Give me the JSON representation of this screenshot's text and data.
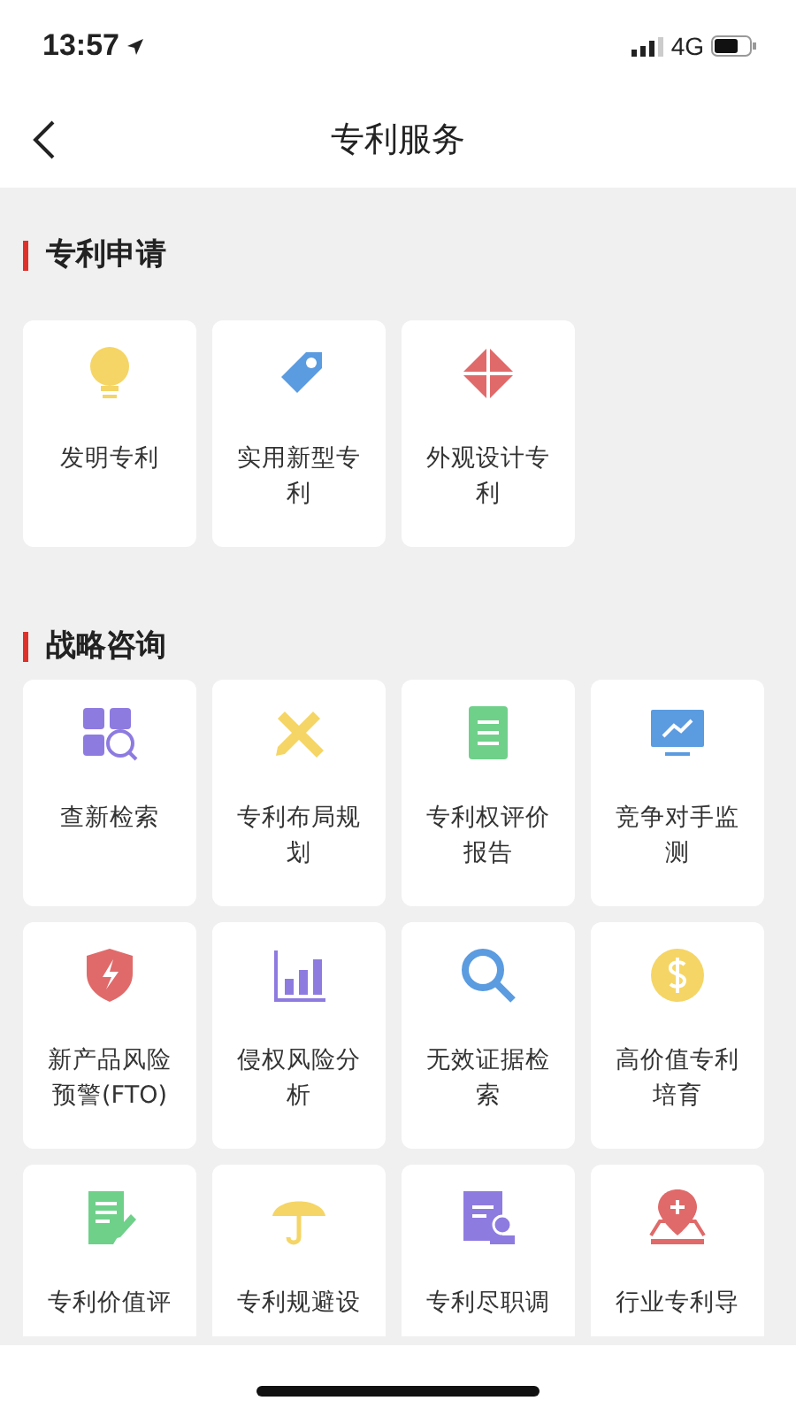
{
  "status_bar": {
    "time": "13:57",
    "network": "4G"
  },
  "nav": {
    "title": "专利服务"
  },
  "sections": [
    {
      "title": "专利申请",
      "items": [
        {
          "label": "发明专利"
        },
        {
          "label": "实用新型专利"
        },
        {
          "label": "外观设计专利"
        }
      ]
    },
    {
      "title": "战略咨询",
      "items": [
        {
          "label": "查新检索"
        },
        {
          "label": "专利布局规划"
        },
        {
          "label": "专利权评价报告"
        },
        {
          "label": "竞争对手监测"
        },
        {
          "label": "新产品风险预警(FTO)"
        },
        {
          "label": "侵权风险分析"
        },
        {
          "label": "无效证据检索"
        },
        {
          "label": "高价值专利培育"
        },
        {
          "label": "专利价值评"
        },
        {
          "label": "专利规避设"
        },
        {
          "label": "专利尽职调"
        },
        {
          "label": "行业专利导"
        }
      ]
    }
  ]
}
